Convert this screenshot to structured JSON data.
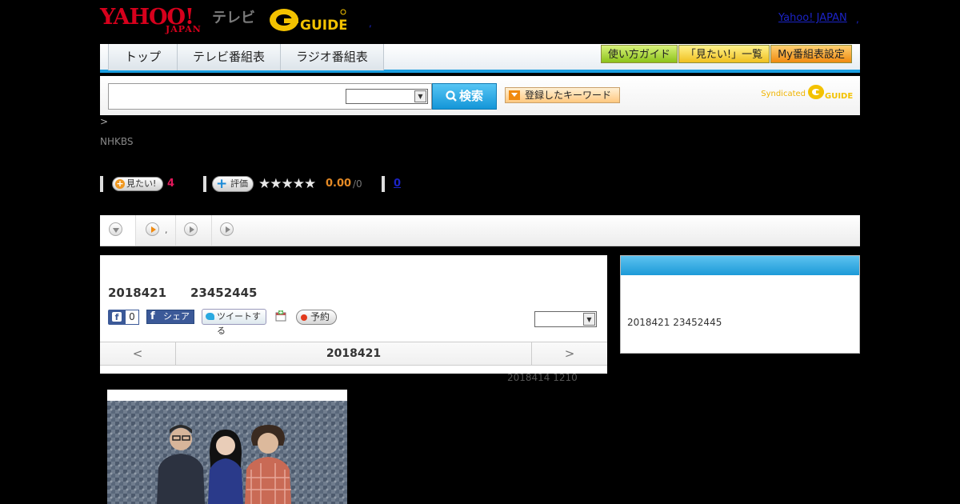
{
  "header": {
    "yahoo_logo_top": "YAHOO!",
    "yahoo_logo_bottom": "JAPAN",
    "tv_label": "テレビ",
    "gguide_logo": "G-GUIDE",
    "yahoo_japan_link": "Yahoo! JAPAN",
    "dot_after_logo": ",",
    "dot_after_link": ","
  },
  "nav": {
    "tabs": [
      {
        "label": "トップ"
      },
      {
        "label": "テレビ番組表"
      },
      {
        "label": "ラジオ番組表"
      }
    ],
    "right_buttons": [
      {
        "label": "使い方ガイド"
      },
      {
        "label": "「見たい!」一覧"
      },
      {
        "label": "My番組表設定"
      }
    ]
  },
  "search": {
    "input_value": "",
    "select_value": "",
    "search_label": "検索",
    "keyword_label": "登録したキーワード",
    "syndicated_label": "Syndicated",
    "gguide_label": "G GUIDE"
  },
  "breadcrumb": {
    "separator": ">"
  },
  "program": {
    "channel": "NHKBS",
    "mitai_label": "見たい!",
    "mitai_count": "4",
    "hyouka_label": "評価",
    "stars": "★★★★★",
    "score": "0.00",
    "score_count": "/0",
    "review_link": "0",
    "date": "2018421",
    "time": "23452445",
    "fb_like_count": "0",
    "fb_share_label": "シェア",
    "tweet_label": "ツイートする",
    "yoyaku_label": "予約",
    "update_text": "2018414  1210"
  },
  "tabs_strip": {
    "dot": ","
  },
  "pager": {
    "prev": "<",
    "date": "2018421",
    "next": ">"
  },
  "side": {
    "text": "2018421  23452445"
  },
  "colors": {
    "accent_blue": "#1a9ee0",
    "brand_red": "#d6001c",
    "mitai_pink": "#e2195b",
    "score_orange": "#e58a25"
  }
}
